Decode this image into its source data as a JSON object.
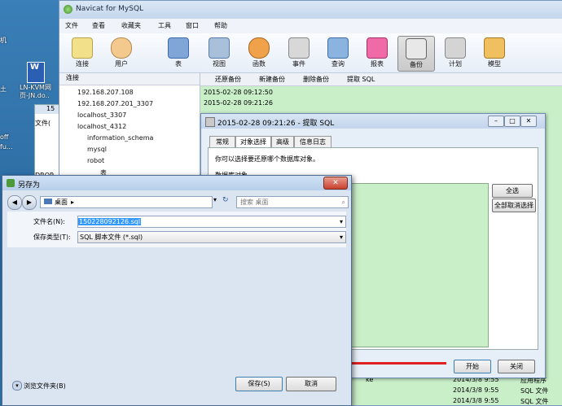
{
  "desktop": {
    "icons": [
      {
        "label": "机"
      },
      {
        "label": "LN-KVM网"
      },
      {
        "label": "页-JN.do.."
      },
      {
        "label": "土"
      },
      {
        "label": "off"
      },
      {
        "label": "fu..."
      }
    ]
  },
  "navicat": {
    "title": "Navicat for MySQL",
    "menu": [
      "文件",
      "查看",
      "收藏夹",
      "工具",
      "窗口",
      "帮助"
    ],
    "toolbar": [
      "连接",
      "用户",
      "表",
      "视图",
      "函数",
      "事件",
      "查询",
      "报表",
      "备份",
      "计划",
      "模型"
    ],
    "active_tool": "备份",
    "sidebar_header": "连接",
    "tree": [
      "192.168.207.108",
      "192.168.207.201_3307",
      "localhost_3307",
      "localhost_4312",
      "information_schema",
      "mysql",
      "robot",
      "表"
    ],
    "obj_toolbar": [
      "还原备份",
      "新建备份",
      "删除备份",
      "提取 SQL"
    ],
    "backups": [
      "2015-02-28 09:12:50",
      "2015-02-28 09:21:26"
    ],
    "bottom_rows": [
      {
        "date": "2014/3/8 9:55",
        "type": "应用程序"
      },
      {
        "date": "2014/3/8 9:55",
        "type": "SQL 文件"
      },
      {
        "date": "2014/3/8 9:55",
        "type": "SQL 文件"
      }
    ],
    "bottom_fragment": "ke"
  },
  "backup_dialog": {
    "title": "2015-02-28 09:21:26 - 提取 SQL",
    "tabs": [
      "常规",
      "对象选择",
      "高级",
      "信息日志"
    ],
    "active_tab": "对象选择",
    "instruction": "你可以选择要还原哪个数据库对象。",
    "objects_label": "数据库对象",
    "select_all": "全选",
    "deselect_all": "全部取消选择",
    "start": "开始",
    "close": "关闭"
  },
  "left_peek": {
    "tab": "15",
    "label": "文件(",
    "drop": "DROP"
  },
  "save_dialog": {
    "title": "另存为",
    "location": "桌面",
    "search_placeholder": "搜索 桌面",
    "filename_label": "文件名(N):",
    "filename_value": "150228092126.sql",
    "filetype_label": "保存类型(T):",
    "filetype_value": "SQL 脚本文件 (*.sql)",
    "browse_folders": "浏览文件夹(B)",
    "save": "保存(S)",
    "cancel": "取消"
  }
}
